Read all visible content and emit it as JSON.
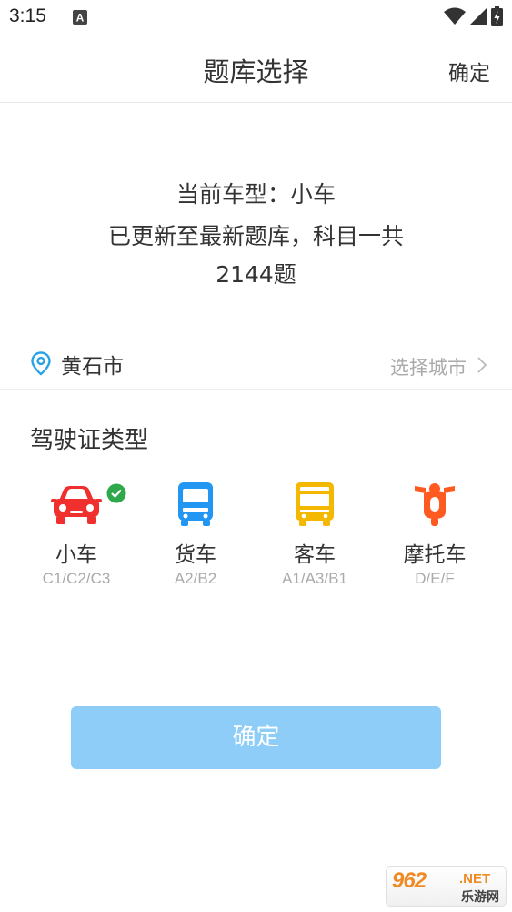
{
  "status_bar": {
    "time": "3:15",
    "icons": [
      "a-notification-icon",
      "wifi-icon",
      "signal-icon",
      "battery-icon"
    ]
  },
  "header": {
    "title": "题库选择",
    "confirm_label": "确定"
  },
  "info": {
    "line1": "当前车型：小车",
    "line2": "已更新至最新题库，科目一共",
    "line3": "2144题"
  },
  "city": {
    "name": "黄石市",
    "select_label": "选择城市",
    "icon": "location-pin-icon"
  },
  "license": {
    "section_title": "驾驶证类型",
    "selected": "小车",
    "types": [
      {
        "name": "小车",
        "code": "C1/C2/C3",
        "icon": "car-icon",
        "color": "#f0302e"
      },
      {
        "name": "货车",
        "code": "A2/B2",
        "icon": "truck-icon",
        "color": "#2196f3"
      },
      {
        "name": "客车",
        "code": "A1/A3/B1",
        "icon": "bus-icon",
        "color": "#f5b800"
      },
      {
        "name": "摩托车",
        "code": "D/E/F",
        "icon": "motorcycle-icon",
        "color": "#ff5a1f"
      }
    ]
  },
  "confirm_button": {
    "label": "确定",
    "color": "#8dcdf7"
  },
  "watermark": {
    "main": "962",
    "net": ".NET",
    "sub": "乐游网"
  },
  "colors": {
    "accent": "#8dcdf7",
    "check": "#2ea84a",
    "pin": "#2aa3e6"
  }
}
